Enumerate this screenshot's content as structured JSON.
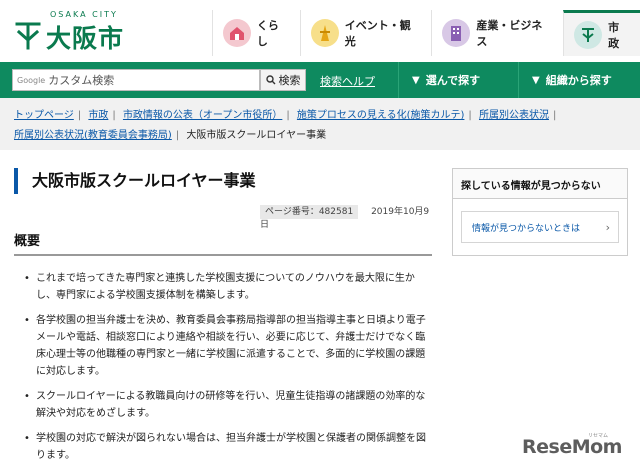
{
  "header": {
    "logo_sub": "OSAKA CITY",
    "logo_text": "大阪市",
    "nav": [
      {
        "label": "くらし",
        "icon": "house-icon",
        "color": "#f4c8cf"
      },
      {
        "label": "イベント・観光",
        "icon": "tower-icon",
        "color": "#f7df8a"
      },
      {
        "label": "産業・ビジネス",
        "icon": "building-icon",
        "color": "#d8c8e6"
      },
      {
        "label": "市政",
        "icon": "city-emblem-icon",
        "color": "#cfe8e4"
      }
    ]
  },
  "search": {
    "google_label": "Google",
    "placeholder": "カスタム検索",
    "button": "検索",
    "help": "検索ヘルプ",
    "nav_select": "選んで探す",
    "nav_org": "組織から探す"
  },
  "breadcrumb": {
    "items": [
      "トップページ",
      "市政",
      "市政情報の公表（オープン市役所）",
      "施策プロセスの見える化(施策カルテ)",
      "所属別公表状況",
      "所属別公表状況(教育委員会事務局)"
    ],
    "current": "大阪市版スクールロイヤー事業"
  },
  "main": {
    "title": "大阪市版スクールロイヤー事業",
    "page_id": "ページ番号：482581",
    "date": "2019年10月9日",
    "section_heading": "概要",
    "bullets": [
      "これまで培ってきた専門家と連携した学校園支援についてのノウハウを最大限に生かし、専門家による学校園支援体制を構築します。",
      "各学校園の担当弁護士を決め、教育委員会事務局指導部の担当指導主事と日頃より電子メールや電話、相談窓口により連絡や相談を行い、必要に応じて、弁護士だけでなく臨床心理士等の他職種の専門家と一緒に学校園に派遣することで、多面的に学校園の課題に対応します。",
      "スクールロイヤーによる教職員向けの研修等を行い、児童生徒指導の諸課題の効率的な解決や対応をめざします。",
      "学校園の対応で解決が図られない場合は、担当弁護士が学校園と保護者の関係調整を図ります。"
    ]
  },
  "sidebar": {
    "heading": "探している情報が見つからない",
    "link": "情報が見つからないときは"
  },
  "watermark": {
    "text": "ReseMom",
    "sub": "リセマム"
  },
  "colors": {
    "brand_green": "#0e8a5f",
    "link_blue": "#0a58a8"
  }
}
